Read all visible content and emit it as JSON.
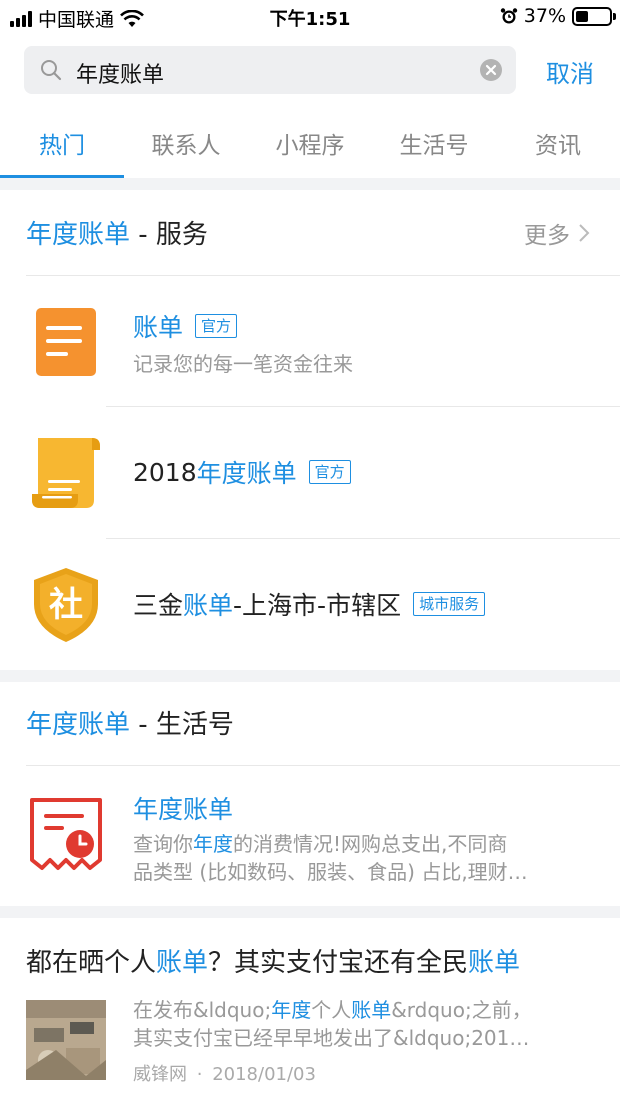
{
  "status_bar": {
    "carrier": "中国联通",
    "time": "下午1:51",
    "battery": "37%",
    "battery_level": 0.37
  },
  "search": {
    "query": "年度账单",
    "cancel_label": "取消"
  },
  "tabs": [
    {
      "label": "热门",
      "active": true
    },
    {
      "label": "联系人",
      "active": false
    },
    {
      "label": "小程序",
      "active": false
    },
    {
      "label": "生活号",
      "active": false
    },
    {
      "label": "资讯",
      "active": false
    }
  ],
  "services": {
    "title_highlight": "年度账单",
    "title_rest": " - 服务",
    "more_label": "更多",
    "items": [
      {
        "title": "账单",
        "tag": "官方",
        "subtitle": "记录您的每一笔资金往来",
        "icon": "bill-document-icon"
      },
      {
        "title_prefix": "2018 ",
        "title_highlight": "年度账单",
        "tag": "官方",
        "icon": "scroll-icon"
      },
      {
        "title_prefix": "三金",
        "title_highlight": "账单",
        "title_suffix": "-上海市-市辖区",
        "tag": "城市服务",
        "icon": "social-security-shield-icon",
        "icon_char": "社"
      }
    ]
  },
  "life_accounts": {
    "title_highlight": "年度账单",
    "title_rest": " - 生活号",
    "item": {
      "title": "年度账单",
      "desc_part1": "查询你",
      "desc_highlight": "年度",
      "desc_part2": "的消费情况!网购总支出,不同商",
      "desc_line2": "品类型 (比如数码、服装、食品) 占比,理财…"
    }
  },
  "article": {
    "title_part1": "都在晒个人",
    "title_hl1": "账单",
    "title_part2": "？其实支付宝还有全民",
    "title_hl2": "账单",
    "summary_part1": "在发布&ldquo;",
    "summary_hl1": "年度",
    "summary_part2": "个人",
    "summary_hl2": "账单",
    "summary_part3": "&rdquo;之前，",
    "summary_line2": "其实支付宝已经早早地发出了&ldquo;201…",
    "source": "威锋网",
    "separator": "·",
    "date": "2018/01/03"
  }
}
